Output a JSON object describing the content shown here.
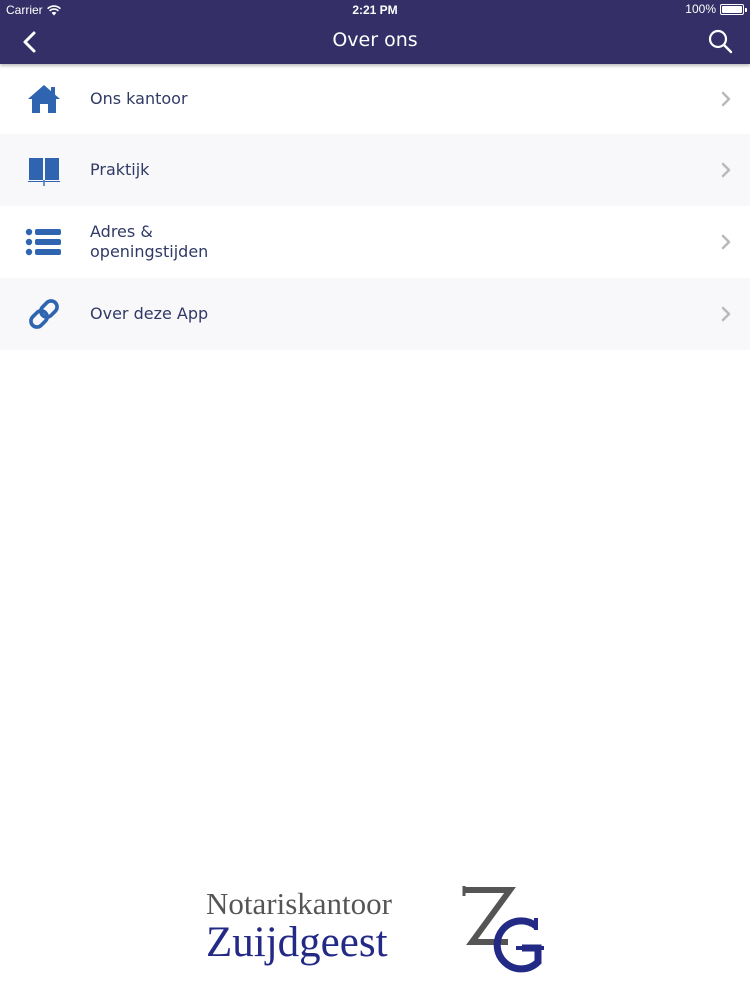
{
  "status_bar": {
    "carrier": "Carrier",
    "time": "2:21 PM",
    "battery": "100%",
    "battery_level": 1.0
  },
  "nav": {
    "title": "Over ons",
    "back_icon": "chevron-left-icon",
    "search_icon": "search-icon"
  },
  "menu": {
    "items": [
      {
        "label": "Ons kantoor",
        "icon": "home-icon"
      },
      {
        "label": "Praktijk",
        "icon": "book-icon"
      },
      {
        "label": "Adres &\nopeningstijden",
        "icon": "list-icon"
      },
      {
        "label": "Over deze App",
        "icon": "link-icon"
      }
    ]
  },
  "logo": {
    "line1": "Notariskantoor",
    "line2": "Zuijdgeest",
    "monogram": "ZG"
  },
  "colors": {
    "nav_background": "#342f66",
    "icon_blue": "#2e64b0",
    "text_dark": "#2f3a66",
    "chevron_gray": "#b8b8bd",
    "logo_blue": "#232a85",
    "logo_gray": "#555555"
  }
}
